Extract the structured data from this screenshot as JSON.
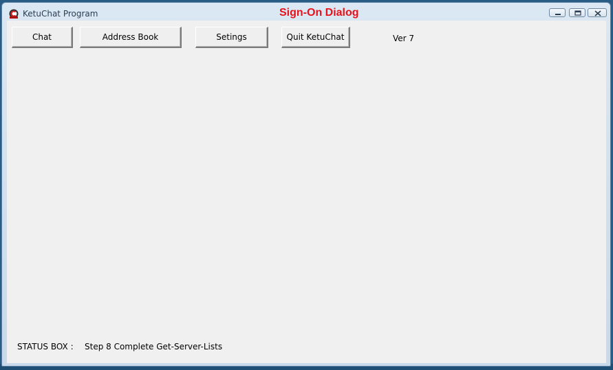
{
  "window": {
    "app_title": "KetuChat Program",
    "dialog_title": "Sign-On Dialog",
    "title_color": "#e8101a",
    "icon": "ketuchat-app-icon",
    "controls": {
      "minimize_icon": "minimize-icon",
      "maximize_icon": "maximize-icon",
      "close_icon": "close-icon"
    }
  },
  "toolbar": {
    "chat_label": "Chat",
    "address_book_label": "Address Book",
    "settings_label": "Setings",
    "quit_label": "Quit KetuChat",
    "version": "Ver 7"
  },
  "status": {
    "label": "STATUS BOX :",
    "text": "Step 8 Complete Get-Server-Lists"
  }
}
